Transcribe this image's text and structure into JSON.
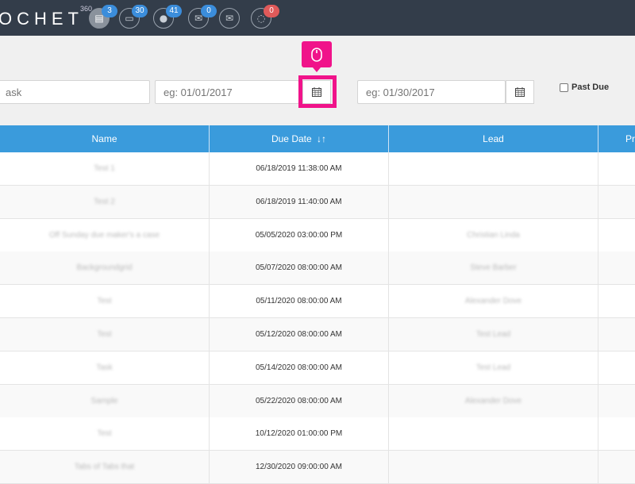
{
  "app": {
    "logo": "OCHET",
    "logo_sup": "360"
  },
  "nav_icons": [
    {
      "name": "tasks-icon",
      "badge": "3",
      "badge_color": "#3b8ddb",
      "glyph": "▤"
    },
    {
      "name": "documents-icon",
      "badge": "30",
      "badge_color": "#3b8ddb",
      "glyph": "▭"
    },
    {
      "name": "chat-icon",
      "badge": "41",
      "badge_color": "#3b8ddb",
      "glyph": "●"
    },
    {
      "name": "mail-icon",
      "badge": "0",
      "badge_color": "#3b8ddb",
      "glyph": "✉"
    },
    {
      "name": "inbox-icon",
      "badge": "",
      "badge_color": "",
      "glyph": "✉"
    },
    {
      "name": "comment-icon",
      "badge": "0",
      "badge_color": "#e05a5a",
      "glyph": "◌"
    }
  ],
  "filters": {
    "task_placeholder": "ask",
    "start_date_placeholder": "eg: 01/01/2017",
    "end_date_placeholder": "eg: 01/30/2017",
    "past_due_label": "Past Due"
  },
  "table": {
    "headers": {
      "name": "Name",
      "due_date": "Due Date",
      "lead": "Lead",
      "extra": "Pr"
    },
    "rows": [
      {
        "name": "Test 1",
        "due_date": "06/18/2019 11:38:00 AM",
        "lead": ""
      },
      {
        "name": "Test 2",
        "due_date": "06/18/2019 11:40:00 AM",
        "lead": ""
      },
      {
        "name": "Off Sunday due maker's a case",
        "due_date": "05/05/2020 03:00:00 PM",
        "lead": "Christian Linda"
      },
      {
        "name": "Backgroundgrid",
        "due_date": "05/07/2020 08:00:00 AM",
        "lead": "Steve Barber"
      },
      {
        "name": "Test",
        "due_date": "05/11/2020 08:00:00 AM",
        "lead": "Alexander Dove"
      },
      {
        "name": "Test",
        "due_date": "05/12/2020 08:00:00 AM",
        "lead": "Test Lead"
      },
      {
        "name": "Task",
        "due_date": "05/14/2020 08:00:00 AM",
        "lead": "Test Lead"
      },
      {
        "name": "Sample",
        "due_date": "05/22/2020 08:00:00 AM",
        "lead": "Alexander Dove"
      },
      {
        "name": "Test",
        "due_date": "10/12/2020 01:00:00 PM",
        "lead": ""
      },
      {
        "name": "Tabs of Tabs that",
        "due_date": "12/30/2020 09:00:00 AM",
        "lead": ""
      }
    ]
  },
  "colors": {
    "header_bar": "#333d4a",
    "table_header": "#3a9bdc",
    "highlight": "#f0138a"
  }
}
